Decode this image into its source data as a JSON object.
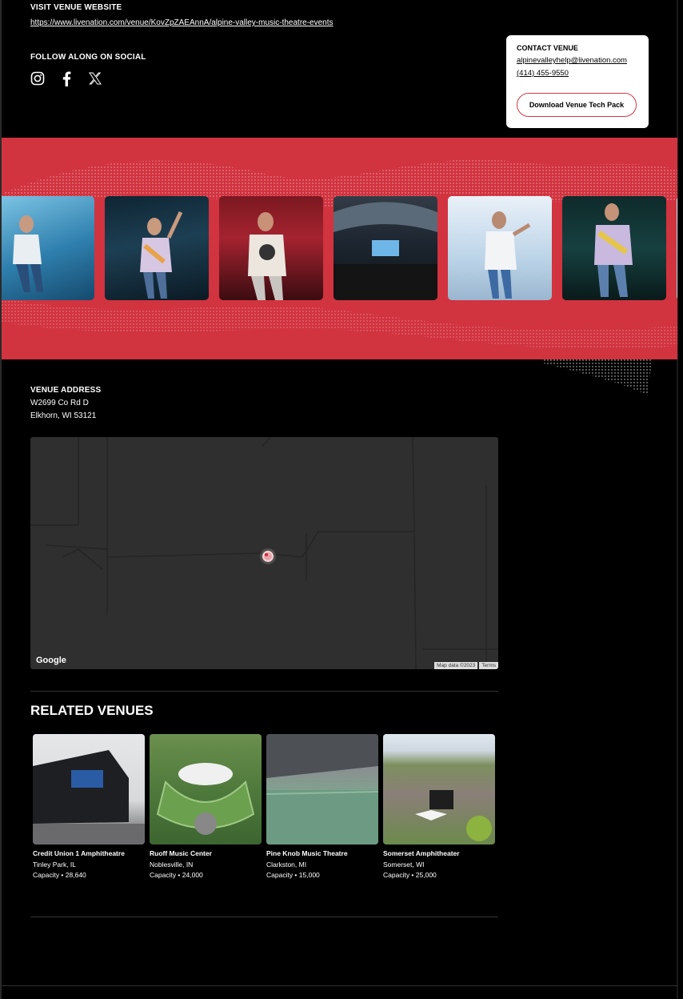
{
  "website": {
    "label": "VISIT VENUE WEBSITE",
    "url": "https://www.livenation.com/venue/KovZpZAEAnnA/alpine-valley-music-theatre-events"
  },
  "social": {
    "label": "FOLLOW ALONG ON SOCIAL",
    "icons": [
      "instagram-icon",
      "facebook-icon",
      "x-icon"
    ]
  },
  "contact": {
    "title": "CONTACT VENUE",
    "email": "alpinevalleyhelp@livenation.com",
    "phone": "(414) 455-9550",
    "tech_pack_label": "Download Venue Tech Pack"
  },
  "gallery": {
    "background": "#d1333f",
    "photos": [
      "performer-photo-1",
      "performer-photo-2",
      "performer-photo-3",
      "venue-crowd-photo",
      "performer-photo-5",
      "performer-photo-6"
    ]
  },
  "address": {
    "label": "VENUE ADDRESS",
    "line1": "W2699 Co Rd D",
    "line2": "Elkhorn, WI 53121"
  },
  "map": {
    "brand": "Google",
    "data_credit": "Map data ©2023",
    "terms": "Terms"
  },
  "related": {
    "title": "RELATED VENUES",
    "venues": [
      {
        "name": "Credit Union 1 Amphitheatre",
        "location": "Tinley Park, IL",
        "capacity": "Capacity • 28,640"
      },
      {
        "name": "Ruoff Music Center",
        "location": "Noblesville, IN",
        "capacity": "Capacity • 24,000"
      },
      {
        "name": "Pine Knob Music Theatre",
        "location": "Clarkston, MI",
        "capacity": "Capacity • 15,000"
      },
      {
        "name": "Somerset Amphitheater",
        "location": "Somerset, WI",
        "capacity": "Capacity • 25,000"
      }
    ]
  }
}
